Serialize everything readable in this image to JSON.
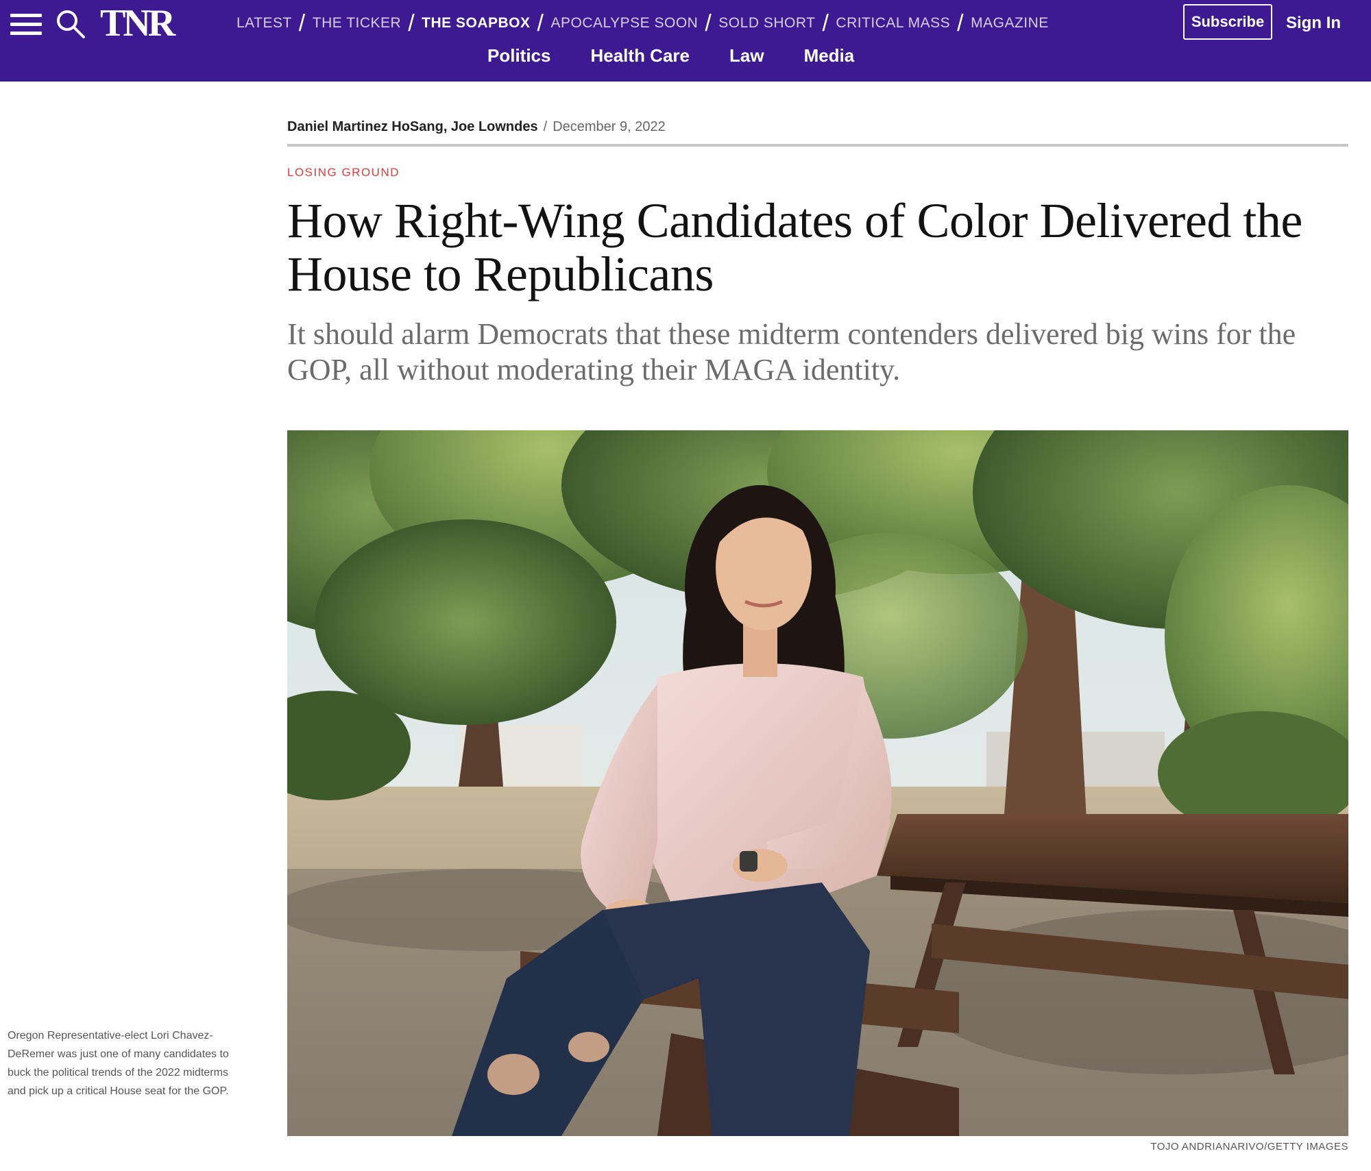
{
  "header": {
    "logo": "TNR",
    "menu_icon": "hamburger-menu-icon",
    "search_icon": "search-icon",
    "sections": [
      {
        "label": "LATEST",
        "active": false
      },
      {
        "label": "THE TICKER",
        "active": false
      },
      {
        "label": "THE SOAPBOX",
        "active": true
      },
      {
        "label": "APOCALYPSE SOON",
        "active": false
      },
      {
        "label": "SOLD SHORT",
        "active": false
      },
      {
        "label": "CRITICAL MASS",
        "active": false
      },
      {
        "label": "MAGAZINE",
        "active": false
      }
    ],
    "topics": [
      "Politics",
      "Health Care",
      "Law",
      "Media"
    ],
    "subscribe_label": "Subscribe",
    "signin_label": "Sign In",
    "brand_color": "#3d1a91"
  },
  "article": {
    "authors": "Daniel Martinez HoSang, Joe Lowndes",
    "separator": "/",
    "date": "December 9, 2022",
    "kicker": "LOSING GROUND",
    "kicker_color": "#e03b3b",
    "headline": "How Right-Wing Candidates of Color Delivered the House to Republicans",
    "dek": "It should alarm Democrats that these midterm contenders delivered big wins for the GOP, all without moderating their MAGA identity."
  },
  "hero": {
    "caption": "Oregon Representative-elect Lori Chavez-DeRemer was just one of many candidates to buck the political trends of the 2022 midterms and pick up a critical House seat for the GOP.",
    "credit": "TOJO ANDRIANARIVO/GETTY IMAGES"
  }
}
